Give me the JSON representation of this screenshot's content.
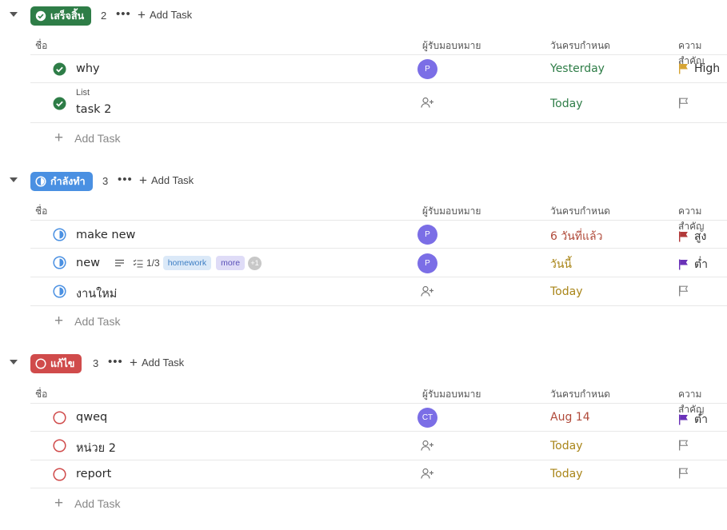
{
  "columns": {
    "name": "ชื่อ",
    "assignee": "ผู้รับมอบหมาย",
    "due": "วันครบกำหนด",
    "priority": "ความสำคัญ"
  },
  "add_task_label": "Add Task",
  "colors": {
    "done": "#2e7d47",
    "in_progress": "#4a90e2",
    "fix": "#d04b4b",
    "due_green": "#2e7d47",
    "due_red": "#b04a3a",
    "due_yellow": "#a98518",
    "flag_high": "#d6a434",
    "flag_urgent": "#b23a3a",
    "flag_low": "#6a32b8",
    "avatar": "#7b6ee6"
  },
  "groups": [
    {
      "label": "เสร็จสิ้น",
      "count": "2",
      "tasks": [
        {
          "name": "why",
          "list": "",
          "assignee": "P",
          "due": "Yesterday",
          "priority": "High"
        },
        {
          "name": "task 2",
          "list": "List",
          "assignee": "",
          "due": "Today",
          "priority": ""
        }
      ]
    },
    {
      "label": "กำลังทำ",
      "count": "3",
      "tasks": [
        {
          "name": "make new",
          "list": "",
          "assignee": "P",
          "due": "6 วันที่แล้ว",
          "priority": "สูง"
        },
        {
          "name": "new",
          "list": "",
          "assignee": "P",
          "due": "วันนี้",
          "priority": "ต่ำ",
          "subtasks": "1/3",
          "tags": [
            "homework",
            "more"
          ],
          "extra_tags": "+1"
        },
        {
          "name": "งานใหม่",
          "list": "",
          "assignee": "",
          "due": "Today",
          "priority": ""
        }
      ]
    },
    {
      "label": "แก้ไข",
      "count": "3",
      "tasks": [
        {
          "name": "qweq",
          "list": "",
          "assignee": "CT",
          "due": "Aug 14",
          "priority": "ต่ำ"
        },
        {
          "name": "หน่วย 2",
          "list": "",
          "assignee": "",
          "due": "Today",
          "priority": ""
        },
        {
          "name": "report",
          "list": "",
          "assignee": "",
          "due": "Today",
          "priority": ""
        }
      ]
    }
  ]
}
